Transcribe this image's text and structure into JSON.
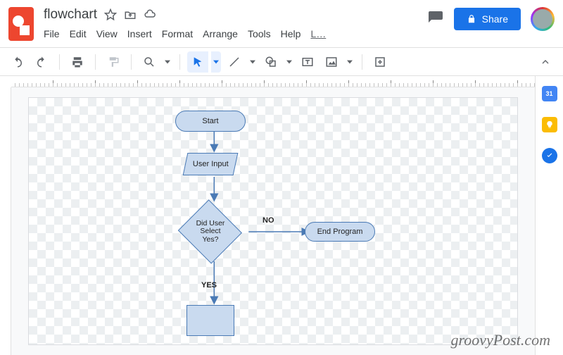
{
  "doc": {
    "title": "flowchart"
  },
  "menubar": {
    "file": "File",
    "edit": "Edit",
    "view": "View",
    "insert": "Insert",
    "format": "Format",
    "arrange": "Arrange",
    "tools": "Tools",
    "help": "Help",
    "last": "L…"
  },
  "header": {
    "share": "Share"
  },
  "sidepanel": {
    "cal": "31"
  },
  "flow": {
    "start": "Start",
    "input": "User Input",
    "decision": "Did User\nSelect\nYes?",
    "yes": "YES",
    "no": "NO",
    "end": "End Program"
  },
  "watermark": "groovyPost.com"
}
